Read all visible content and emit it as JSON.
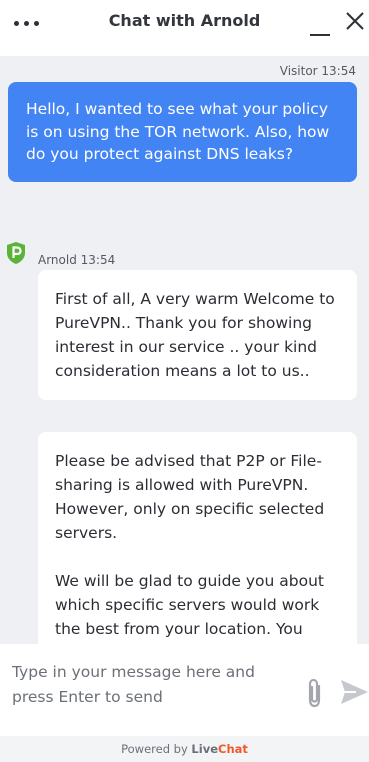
{
  "header": {
    "title": "Chat with Arnold",
    "menu_icon": "more-dots-icon",
    "minimize_icon": "minimize-icon",
    "close_icon": "close-icon"
  },
  "messages": {
    "visitor": {
      "meta": "Visitor 13:54",
      "text": "Hello, I wanted to see what your policy is on using the TOR network. Also, how do you protect against DNS leaks?"
    },
    "agent": {
      "meta": "Arnold 13:54",
      "avatar_icon": "purevpn-logo-icon",
      "bubbles": [
        {
          "paragraphs": [
            "First of all, A very warm Welcome to PureVPN.. Thank you for showing interest in our service .. your kind consideration means a lot to us.."
          ]
        },
        {
          "paragraphs": [
            "Please be advised that P2P or File-sharing is allowed with PureVPN. However, only on specific selected servers.",
            "We will be glad to guide you about which specific servers would work the best from your location. You"
          ]
        }
      ]
    }
  },
  "composer": {
    "placeholder": "Type in your message here and press Enter to send",
    "value": "",
    "attach_icon": "paperclip-icon",
    "send_icon": "send-arrow-icon"
  },
  "footer": {
    "prefix": "Powered by ",
    "brand_live": "Live",
    "brand_chat": "Chat"
  },
  "colors": {
    "visitor_bubble": "#4384f5",
    "brand_green": "#5bb33a",
    "livechat_orange": "#f05a2a"
  }
}
